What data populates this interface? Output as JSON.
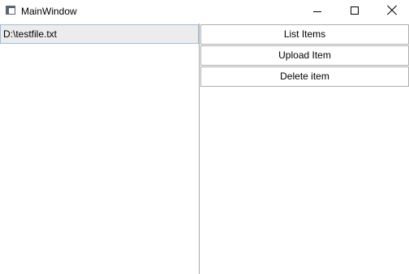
{
  "window": {
    "title": "MainWindow",
    "icon": "app-window-icon"
  },
  "caption_buttons": {
    "minimize": "minimize-icon",
    "maximize": "maximize-icon",
    "close": "close-icon"
  },
  "list": {
    "items": [
      "D:\\testfile.txt"
    ],
    "selected_index": 0
  },
  "actions": {
    "list_label": "List Items",
    "upload_label": "Upload Item",
    "delete_label": "Delete item"
  }
}
